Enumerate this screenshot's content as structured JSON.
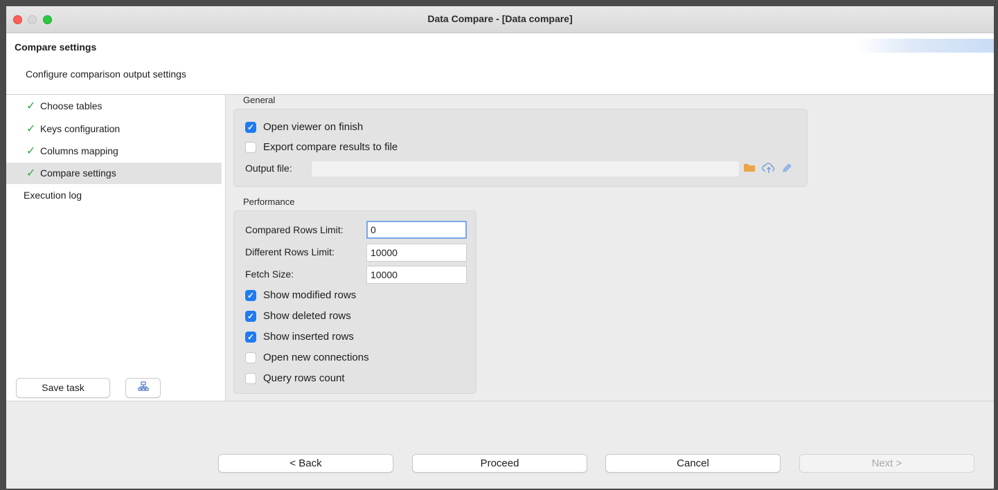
{
  "window": {
    "title": "Data Compare - [Data compare]"
  },
  "header": {
    "title": "Compare settings",
    "subtitle": "Configure comparison output settings"
  },
  "sidebar": {
    "items": [
      {
        "label": "Choose tables",
        "done": true
      },
      {
        "label": "Keys configuration",
        "done": true
      },
      {
        "label": "Columns mapping",
        "done": true
      },
      {
        "label": "Compare settings",
        "done": true
      },
      {
        "label": "Execution log",
        "done": false
      }
    ],
    "save_task_label": "Save task",
    "check_glyph": "✓"
  },
  "general": {
    "label": "General",
    "open_viewer": {
      "label": "Open viewer on finish",
      "checked": true
    },
    "export_results": {
      "label": "Export compare results to file",
      "checked": false
    },
    "output_file_label": "Output file:",
    "output_file_value": ""
  },
  "performance": {
    "label": "Performance",
    "compared_rows_limit": {
      "label": "Compared Rows Limit:",
      "value": "0"
    },
    "different_rows_limit": {
      "label": "Different Rows Limit:",
      "value": "10000"
    },
    "fetch_size": {
      "label": "Fetch Size:",
      "value": "10000"
    },
    "show_modified": {
      "label": "Show modified rows",
      "checked": true
    },
    "show_deleted": {
      "label": "Show deleted rows",
      "checked": true
    },
    "show_inserted": {
      "label": "Show inserted rows",
      "checked": true
    },
    "open_new_connections": {
      "label": "Open new connections",
      "checked": false
    },
    "query_rows_count": {
      "label": "Query rows count",
      "checked": false
    }
  },
  "footer": {
    "back": "< Back",
    "proceed": "Proceed",
    "cancel": "Cancel",
    "next": "Next >"
  },
  "icons": {
    "folder": "folder-icon",
    "cloud": "cloud-upload-icon",
    "edit": "pencil-icon",
    "task_config": "task-config-icon"
  },
  "colors": {
    "accent": "#1f7bf1",
    "check_green": "#3aa24a"
  }
}
